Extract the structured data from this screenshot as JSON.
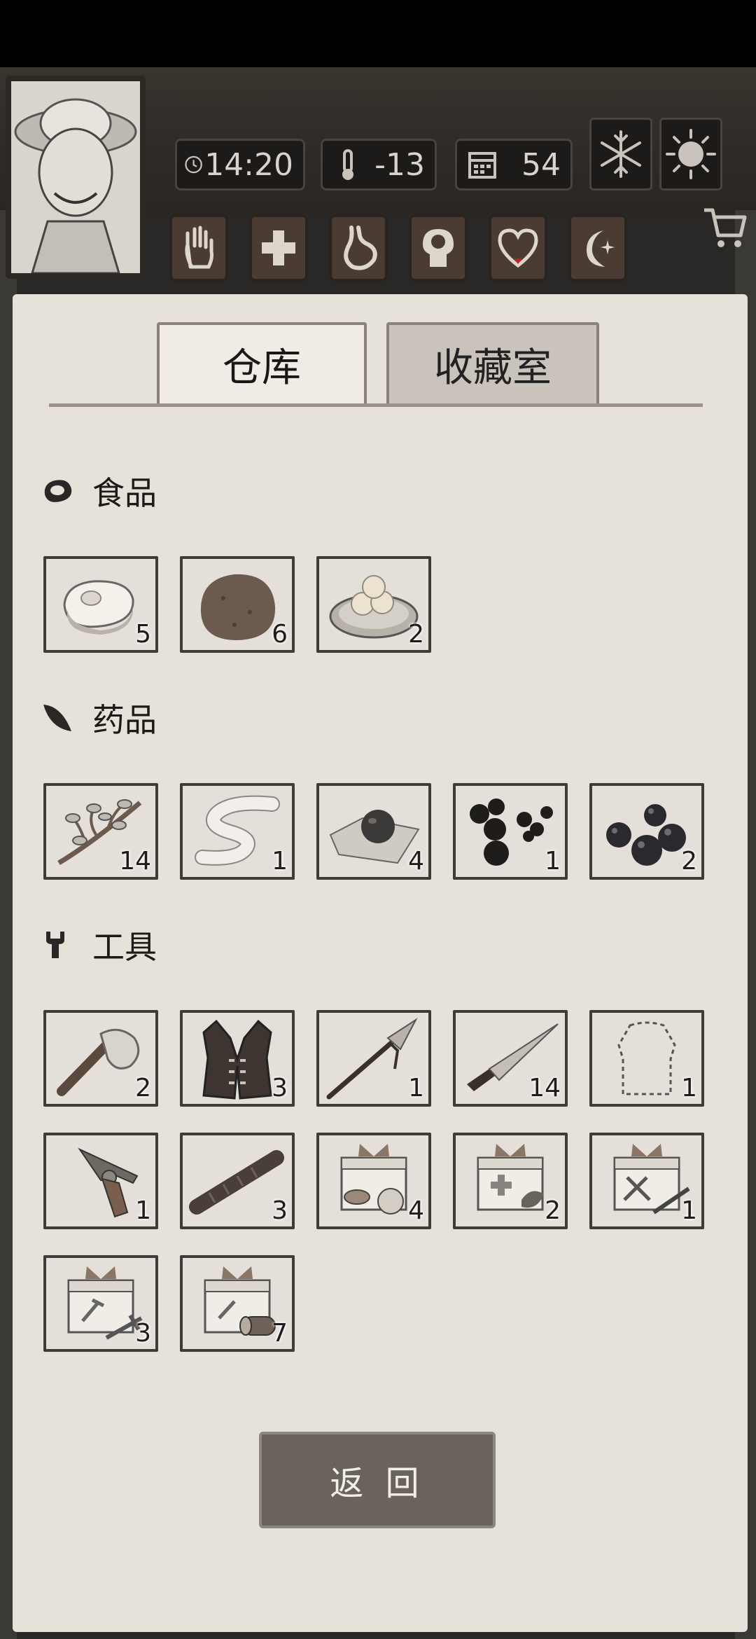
{
  "status": {
    "time": "14:20",
    "temperature": "-13",
    "day": "54"
  },
  "weather_icons": [
    "snowflake-icon",
    "sun-icon"
  ],
  "needs": [
    "hand-icon",
    "medical-cross-icon",
    "stomach-icon",
    "brain-icon",
    "heart-icon",
    "moon-icon"
  ],
  "tabs": {
    "storage": "仓库",
    "collection": "收藏室"
  },
  "categories": {
    "food": {
      "label": "食品",
      "icon": "meat-icon",
      "items": [
        {
          "name": "raw-meat",
          "count": "5"
        },
        {
          "name": "potato",
          "count": "6"
        },
        {
          "name": "rice-balls",
          "count": "2"
        }
      ]
    },
    "medicine": {
      "label": "药品",
      "icon": "leaf-icon",
      "items": [
        {
          "name": "herb-branch",
          "count": "14"
        },
        {
          "name": "bandage",
          "count": "1"
        },
        {
          "name": "pill-on-cloth",
          "count": "4"
        },
        {
          "name": "black-berries",
          "count": "1"
        },
        {
          "name": "black-pills",
          "count": "2"
        }
      ]
    },
    "tools": {
      "label": "工具",
      "icon": "wrench-icon",
      "items": [
        {
          "name": "stone-axe",
          "count": "2"
        },
        {
          "name": "leather-vest",
          "count": "3"
        },
        {
          "name": "spear",
          "count": "1"
        },
        {
          "name": "knife",
          "count": "14"
        },
        {
          "name": "clothing-outline",
          "count": "1"
        },
        {
          "name": "revolver",
          "count": "1"
        },
        {
          "name": "wooden-club",
          "count": "3"
        },
        {
          "name": "food-supply-box",
          "count": "4"
        },
        {
          "name": "medical-supply-box",
          "count": "2"
        },
        {
          "name": "weapon-supply-box",
          "count": "1"
        },
        {
          "name": "tool-supply-box",
          "count": "3"
        },
        {
          "name": "wood-supply-box",
          "count": "7"
        }
      ]
    }
  },
  "back_button": "返 回"
}
